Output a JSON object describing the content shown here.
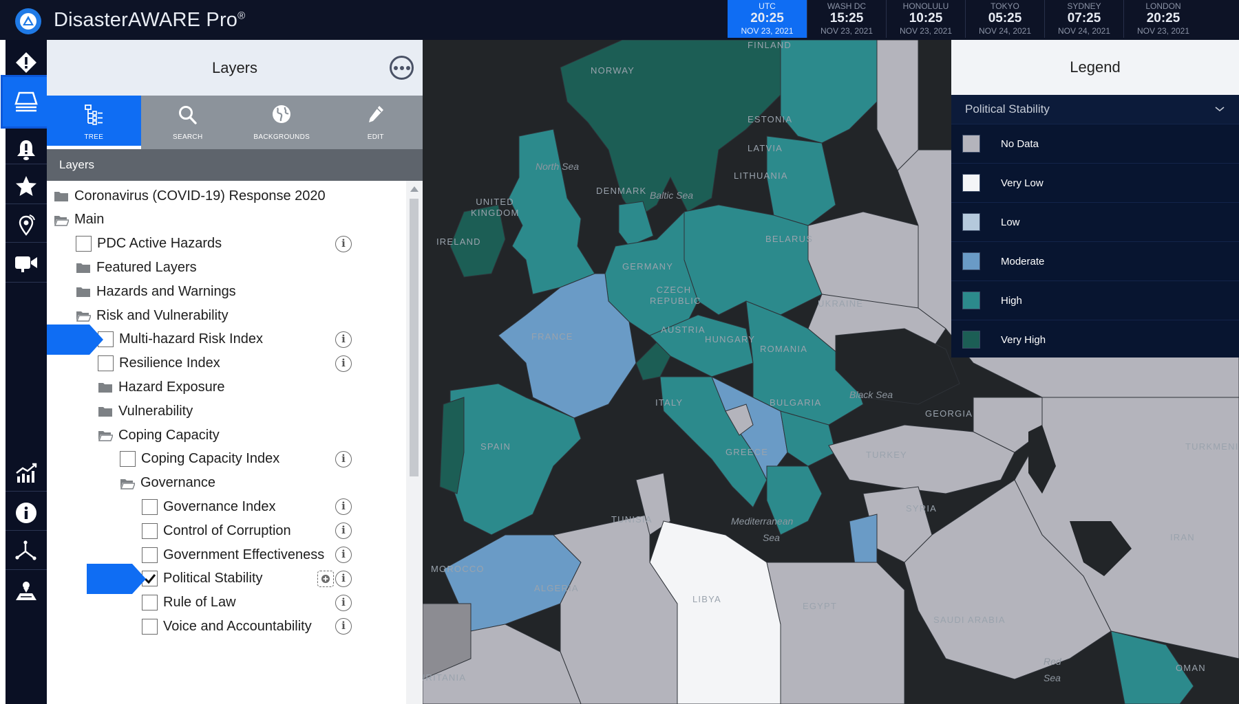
{
  "app": {
    "title": "DisasterAWARE Pro",
    "trademark": "®"
  },
  "clocks": [
    {
      "city": "UTC",
      "time": "20:25",
      "date": "NOV 23, 2021",
      "active": true
    },
    {
      "city": "WASH DC",
      "time": "15:25",
      "date": "NOV 23, 2021"
    },
    {
      "city": "HONOLULU",
      "time": "10:25",
      "date": "NOV 23, 2021"
    },
    {
      "city": "TOKYO",
      "time": "05:25",
      "date": "NOV 24, 2021"
    },
    {
      "city": "SYDNEY",
      "time": "07:25",
      "date": "NOV 24, 2021"
    },
    {
      "city": "LONDON",
      "time": "20:25",
      "date": "NOV 23, 2021"
    }
  ],
  "rail": {
    "items": [
      "hazards-icon",
      "layers-icon",
      "alerts-icon",
      "favorites-icon",
      "location-icon",
      "video-icon",
      "analytics-icon",
      "info-icon",
      "tools-icon",
      "map-icon"
    ]
  },
  "layers_panel": {
    "title": "Layers",
    "tabs": [
      {
        "label": "TREE",
        "icon": "tree-icon"
      },
      {
        "label": "SEARCH",
        "icon": "search-icon"
      },
      {
        "label": "BACKGROUNDS",
        "icon": "globe-icon"
      },
      {
        "label": "EDIT",
        "icon": "pencil-icon"
      }
    ],
    "section": "Layers",
    "tree": [
      {
        "label": "Coronavirus (COVID-19) Response 2020",
        "type": "folder"
      },
      {
        "label": "Main",
        "type": "folder-open"
      },
      {
        "label": "PDC Active Hazards",
        "type": "checkbox"
      },
      {
        "label": "Featured Layers",
        "type": "folder"
      },
      {
        "label": "Hazards and Warnings",
        "type": "folder"
      },
      {
        "label": "Risk and Vulnerability",
        "type": "folder-open"
      },
      {
        "label": "Multi-hazard Risk Index",
        "type": "checkbox"
      },
      {
        "label": "Resilience Index",
        "type": "checkbox"
      },
      {
        "label": "Hazard Exposure",
        "type": "folder"
      },
      {
        "label": "Vulnerability",
        "type": "folder"
      },
      {
        "label": "Coping Capacity",
        "type": "folder-open"
      },
      {
        "label": "Coping Capacity Index",
        "type": "checkbox"
      },
      {
        "label": "Governance",
        "type": "folder-open"
      },
      {
        "label": "Governance Index",
        "type": "checkbox"
      },
      {
        "label": "Control of Corruption",
        "type": "checkbox"
      },
      {
        "label": "Government Effectiveness",
        "type": "checkbox"
      },
      {
        "label": "Political Stability",
        "type": "checkbox",
        "checked": true
      },
      {
        "label": "Rule of Law",
        "type": "checkbox"
      },
      {
        "label": "Voice and Accountability",
        "type": "checkbox"
      }
    ]
  },
  "legend": {
    "title": "Legend",
    "layer": "Political Stability",
    "items": [
      {
        "label": "No Data",
        "color": "#b4b4bc"
      },
      {
        "label": "Very Low",
        "color": "#f4f5f7"
      },
      {
        "label": "Low",
        "color": "#b5c9dc"
      },
      {
        "label": "Moderate",
        "color": "#6a9bc6"
      },
      {
        "label": "High",
        "color": "#2c8a8c"
      },
      {
        "label": "Very High",
        "color": "#1c5e55"
      }
    ]
  },
  "map": {
    "labels": [
      "FINLAND",
      "NORWAY",
      "ESTONIA",
      "LATVIA",
      "LITHUANIA",
      "DENMARK",
      "UNITED KINGDOM",
      "IRELAND",
      "BELARUS",
      "GERMANY",
      "CZECH REPUBLIC",
      "UKRAINE",
      "FRANCE",
      "AUSTRIA",
      "HUNGARY",
      "ROMANIA",
      "ITALY",
      "BULGARIA",
      "GEORGIA",
      "SPAIN",
      "GREECE",
      "TURKEY",
      "TURKMENIS",
      "SYRIA",
      "TUNISIA",
      "IRAN",
      "MOROCCO",
      "ALGERIA",
      "LIBYA",
      "EGYPT",
      "SAUDI ARABIA",
      "MAURITANIA",
      "OMAN"
    ],
    "seas": [
      "North Sea",
      "Baltic Sea",
      "Black Sea",
      "Mediterranean",
      "Sea",
      "Red",
      "Sea"
    ]
  }
}
